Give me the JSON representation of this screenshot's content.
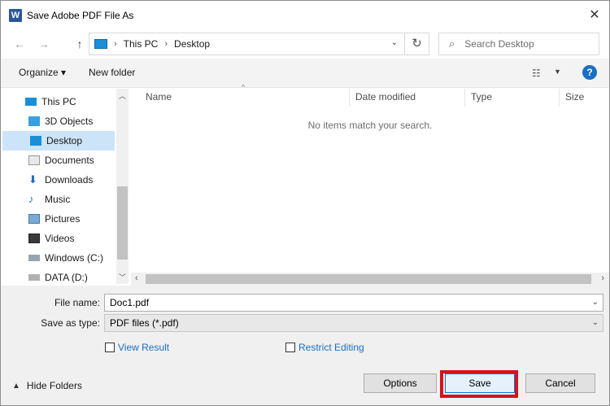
{
  "window": {
    "title": "Save Adobe PDF File As",
    "app_icon": "W"
  },
  "nav": {
    "breadcrumb": [
      "This PC",
      "Desktop"
    ],
    "search_placeholder": "Search Desktop"
  },
  "toolbar": {
    "organize_label": "Organize ▾",
    "new_folder_label": "New folder",
    "help_label": "?"
  },
  "sidebar": {
    "items": [
      {
        "label": "This PC",
        "icon": "pc-icon",
        "selected": false
      },
      {
        "label": "3D Objects",
        "icon": "cube-icon",
        "selected": false
      },
      {
        "label": "Desktop",
        "icon": "desktop-icon",
        "selected": true
      },
      {
        "label": "Documents",
        "icon": "document-icon",
        "selected": false
      },
      {
        "label": "Downloads",
        "icon": "download-icon",
        "selected": false
      },
      {
        "label": "Music",
        "icon": "music-icon",
        "selected": false
      },
      {
        "label": "Pictures",
        "icon": "picture-icon",
        "selected": false
      },
      {
        "label": "Videos",
        "icon": "video-icon",
        "selected": false
      },
      {
        "label": "Windows (C:)",
        "icon": "drive-icon",
        "selected": false
      },
      {
        "label": "DATA (D:)",
        "icon": "drive-icon",
        "selected": false
      }
    ]
  },
  "filelist": {
    "columns": [
      "Name",
      "Date modified",
      "Type",
      "Size"
    ],
    "empty_message": "No items match your search."
  },
  "form": {
    "file_name_label": "File name:",
    "file_name_value": "Doc1.pdf",
    "save_type_label": "Save as type:",
    "save_type_value": "PDF files (*.pdf)",
    "view_result_label": "View Result",
    "restrict_editing_label": "Restrict Editing",
    "hide_folders_label": "Hide Folders"
  },
  "buttons": {
    "options": "Options",
    "save": "Save",
    "cancel": "Cancel"
  },
  "colors": {
    "accent": "#0078d7",
    "selection": "#cce4f7",
    "highlight": "#d6121b",
    "link": "#1a6fc4"
  }
}
